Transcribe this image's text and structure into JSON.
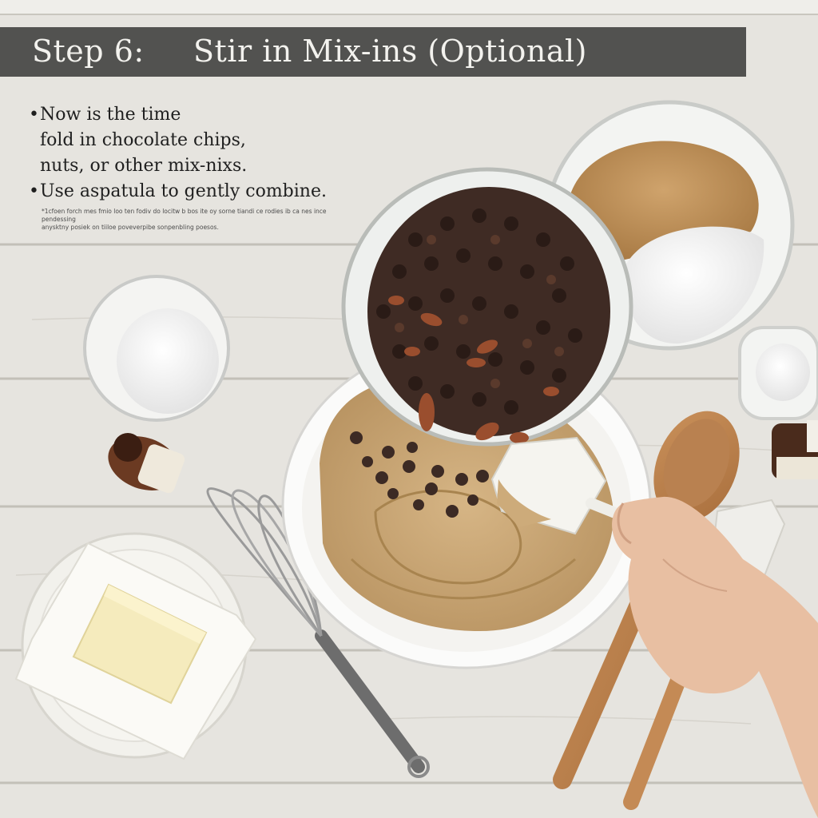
{
  "banner": {
    "step": "Step 6:",
    "title": "Stir in Mix-ins (Optional)"
  },
  "instructions": {
    "bullet1": [
      "Now is the time",
      "fold in chocolate chips,",
      "nuts, or other mix-nixs."
    ],
    "bullet2": "Use aspatula to gently combine.",
    "bullet_char": "•"
  },
  "fine_print": [
    "*1cfoen forch mes fmio loo ten fodiv do locitw b bos ite oy sorne tiandi ce rodies ib ca nes ince pendessing",
    "anysktny posiek on tiiloe poveverpibe sonpenbling poesos."
  ],
  "colors": {
    "banner_bg": "#4a4a48",
    "banner_text": "#f3f2ee",
    "table": "#e6e4df",
    "dough": "#c9a878",
    "chocolate": "#3c2a24",
    "butter": "#f4e9b8"
  }
}
